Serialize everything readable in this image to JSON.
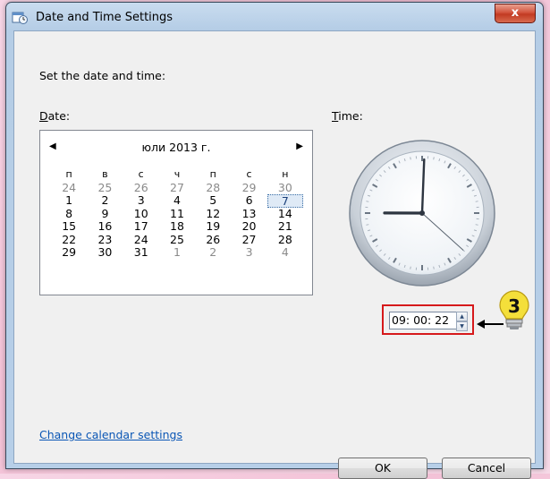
{
  "window": {
    "title": "Date and Time Settings",
    "close_glyph": "x"
  },
  "heading": "Set the date and time:",
  "date_label": {
    "mnemonic": "D",
    "rest": "ate:"
  },
  "time_label": {
    "mnemonic": "T",
    "rest": "ime:"
  },
  "calendar": {
    "month_title": "юли 2013 г.",
    "prev_arrow": "◀",
    "next_arrow": "▶",
    "weekdays": [
      "п",
      "в",
      "с",
      "ч",
      "п",
      "с",
      "н"
    ],
    "weeks": [
      [
        "24",
        "25",
        "26",
        "27",
        "28",
        "29",
        "30"
      ],
      [
        "1",
        "2",
        "3",
        "4",
        "5",
        "6",
        "7"
      ],
      [
        "8",
        "9",
        "10",
        "11",
        "12",
        "13",
        "14"
      ],
      [
        "15",
        "16",
        "17",
        "18",
        "19",
        "20",
        "21"
      ],
      [
        "22",
        "23",
        "24",
        "25",
        "26",
        "27",
        "28"
      ],
      [
        "29",
        "30",
        "31",
        "1",
        "2",
        "3",
        "4"
      ]
    ],
    "selected_day": "7"
  },
  "clock": {
    "hour": 9,
    "minute": 0,
    "second": 22
  },
  "time_input": {
    "value": "09: 00: 22",
    "spin_up": "▲",
    "spin_down": "▼"
  },
  "annotation": {
    "number": "3",
    "arrow": "←"
  },
  "link": "Change calendar settings",
  "buttons": {
    "ok": "OK",
    "cancel": "Cancel"
  },
  "colors": {
    "highlight_border": "#d6191b",
    "link": "#0a56b5",
    "bulb": "#f4df3a"
  }
}
